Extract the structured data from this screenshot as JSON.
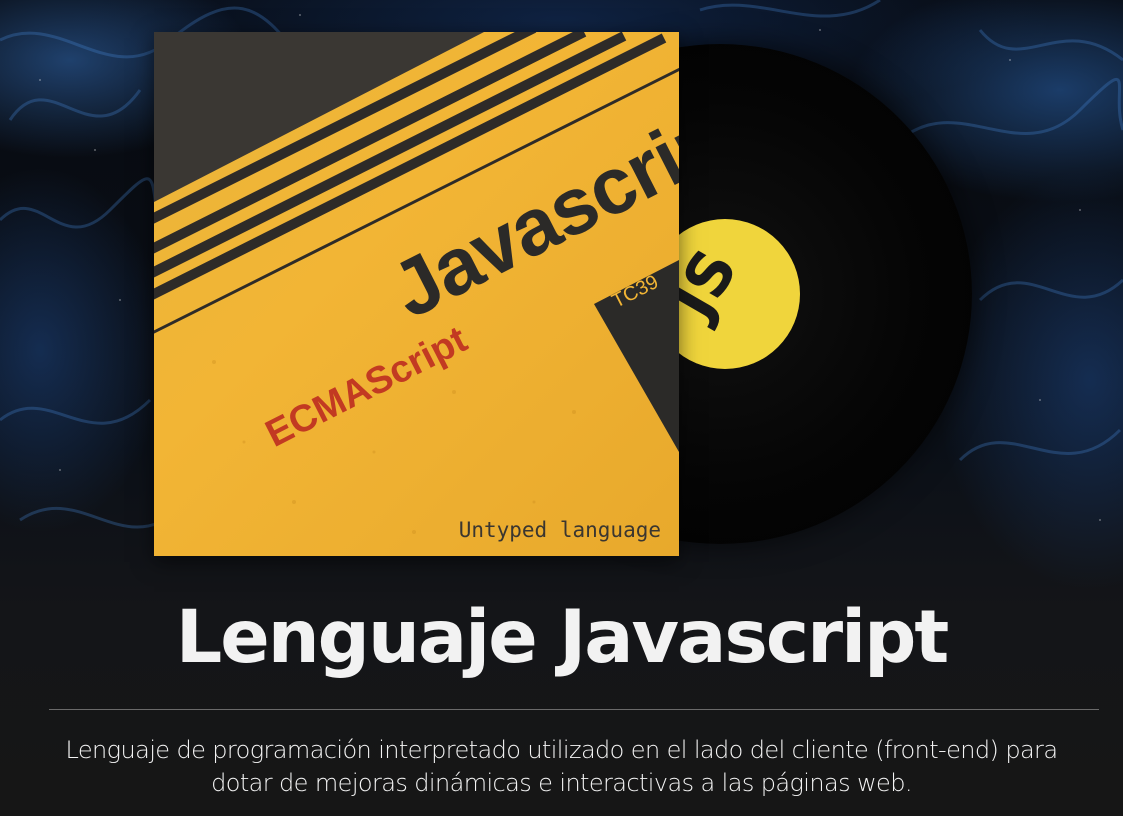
{
  "cover": {
    "title": "Javascript",
    "subtitle": "ECMAScript",
    "tag": "TC39",
    "footer": "Untyped language"
  },
  "vinyl": {
    "label_text": "JS"
  },
  "content": {
    "heading": "Lenguaje Javascript",
    "description": "Lenguaje de programación interpretado utilizado en el lado del cliente (front-end) para dotar de mejoras dinámicas e interactivas a las páginas web."
  },
  "colors": {
    "cover_yellow": "#f2b535",
    "vinyl_label_yellow": "#f0d53c",
    "subtitle_red": "#c23a22",
    "text_light": "#f2f2f2",
    "smoke_blue": "#3c82dc"
  }
}
